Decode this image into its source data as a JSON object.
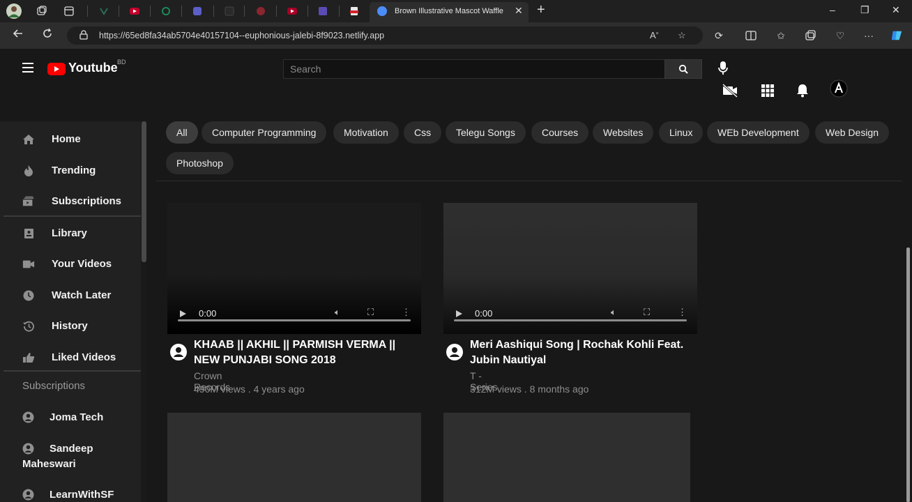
{
  "browser": {
    "active_tab_title": "Brown Illustrative Mascot Waffle",
    "url": "https://65ed8fa34ab5704e40157104--euphonious-jalebi-8f9023.netlify.app",
    "window_controls": {
      "minimize": "–",
      "restore": "❐",
      "close": "✕"
    },
    "new_tab": "+"
  },
  "app": {
    "logo_text": "Youtube",
    "logo_sup": "BD",
    "brand_color": "#ff0000"
  },
  "search": {
    "placeholder": "Search"
  },
  "sidebar": {
    "items": [
      {
        "label": "Home",
        "icon": "home-icon"
      },
      {
        "label": "Trending",
        "icon": "flame-icon"
      },
      {
        "label": "Subscriptions",
        "icon": "subscriptions-icon"
      },
      {
        "label": "Library",
        "icon": "library-icon"
      },
      {
        "label": "Your Videos",
        "icon": "video-camera-icon"
      },
      {
        "label": "Watch Later",
        "icon": "clock-icon"
      },
      {
        "label": "History",
        "icon": "history-icon"
      },
      {
        "label": "Liked Videos",
        "icon": "thumbs-up-icon"
      }
    ],
    "subscriptions_heading": "Subscriptions",
    "subscriptions": [
      "Joma Tech",
      "Sandeep Maheswari",
      "LearnWithSF"
    ]
  },
  "chips": [
    "All",
    "Computer Programming",
    "Motivation",
    "Css",
    "Telegu Songs",
    "Courses",
    "Websites",
    "Linux",
    "WEb Development",
    "Web Design",
    "Photoshop"
  ],
  "videos": [
    {
      "title": "KHAAB || AKHIL || PARMISH VERMA || NEW PUNJABI SONG 2018",
      "channel": "Crown Records",
      "meta": "490M views . 4 years ago",
      "time": "0:00"
    },
    {
      "title": "Meri Aashiqui Song | Rochak Kohli Feat. Jubin Nautiyal",
      "channel": "T - Series",
      "meta": "312M views . 8 months ago",
      "time": "0:00"
    }
  ]
}
